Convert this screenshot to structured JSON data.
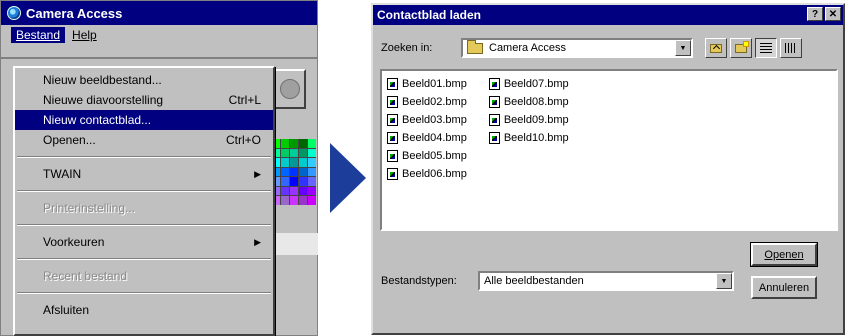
{
  "left_window": {
    "title": "Camera Access",
    "menubar": [
      {
        "label": "Bestand",
        "active": true
      },
      {
        "label": "Help",
        "active": false
      }
    ],
    "dropdown": [
      {
        "label": "Nieuw beeldbestand...",
        "shortcut": "",
        "state": "normal",
        "submenu": false
      },
      {
        "label": "Nieuwe diavoorstelling",
        "shortcut": "Ctrl+L",
        "state": "normal",
        "submenu": false
      },
      {
        "label": "Nieuw contactblad...",
        "shortcut": "",
        "state": "selected",
        "submenu": false
      },
      {
        "label": "Openen...",
        "shortcut": "Ctrl+O",
        "state": "normal",
        "submenu": false
      },
      {
        "separator": true
      },
      {
        "label": "TWAIN",
        "shortcut": "",
        "state": "normal",
        "submenu": true
      },
      {
        "separator": true
      },
      {
        "label": "Printerinstelling...",
        "shortcut": "",
        "state": "disabled",
        "submenu": false
      },
      {
        "separator": true
      },
      {
        "label": "Voorkeuren",
        "shortcut": "",
        "state": "normal",
        "submenu": true
      },
      {
        "separator": true
      },
      {
        "label": "Recent bestand",
        "shortcut": "",
        "state": "disabled",
        "submenu": false
      },
      {
        "separator": true
      },
      {
        "label": "Afsluiten",
        "shortcut": "",
        "state": "normal",
        "submenu": false
      }
    ],
    "palette_colors": [
      "#00ff00",
      "#00cc00",
      "#009900",
      "#006600",
      "#00ff66",
      "#00ff99",
      "#00cc66",
      "#00cc99",
      "#009966",
      "#00ffcc",
      "#00ffff",
      "#00cccc",
      "#009999",
      "#00cccc",
      "#33ccff",
      "#0099ff",
      "#0066ff",
      "#0033ff",
      "#0066cc",
      "#3399ff",
      "#6699ff",
      "#3366ff",
      "#0000ff",
      "#3333ff",
      "#6666ff",
      "#9966ff",
      "#6633ff",
      "#9933ff",
      "#6600ff",
      "#9900ff",
      "#cc66ff",
      "#9966cc",
      "#cc33ff",
      "#9933cc",
      "#cc00ff"
    ]
  },
  "dialog": {
    "title": "Contactblad laden",
    "title_buttons": [
      "?",
      "✕"
    ],
    "look_in_label": "Zoeken in:",
    "look_in_value": "Camera Access",
    "files_col1": [
      "Beeld01.bmp",
      "Beeld02.bmp",
      "Beeld03.bmp",
      "Beeld04.bmp",
      "Beeld05.bmp",
      "Beeld06.bmp"
    ],
    "files_col2": [
      "Beeld07.bmp",
      "Beeld08.bmp",
      "Beeld09.bmp",
      "Beeld10.bmp"
    ],
    "type_label": "Bestandstypen:",
    "type_value": "Alle beeldbestanden",
    "open_button": "Openen",
    "cancel_button": "Annuleren"
  },
  "colors": {
    "title_bar": "#000080",
    "arrow": "#1c3d9a",
    "face": "#c0c0c0"
  }
}
